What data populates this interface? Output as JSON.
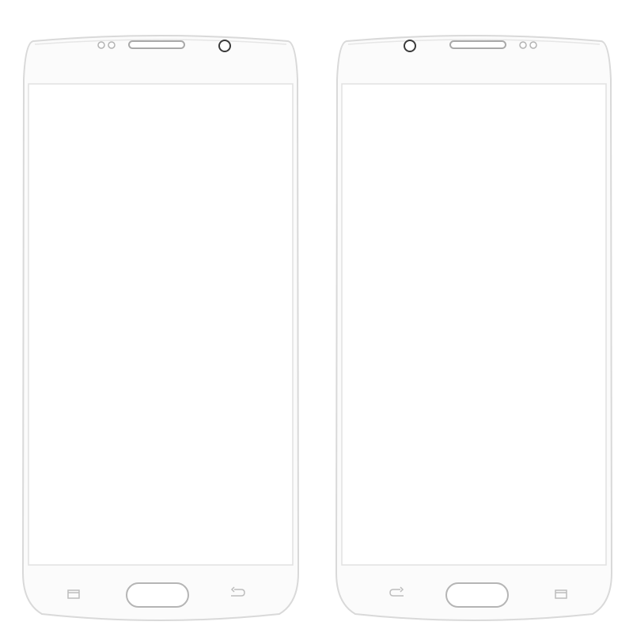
{
  "scene": {
    "background": "#ffffff",
    "glass_color": "#fbfbfb",
    "outline_color": "#d9d9d9",
    "detail_color": "#bdbdbd",
    "icon_color": "#b8b8b8"
  },
  "panels": [
    {
      "view": "front",
      "flipped": false,
      "icons": [
        "speaker-grille-icon",
        "sensor-dots-icon",
        "front-camera-icon",
        "home-button-icon",
        "recent-apps-icon",
        "back-arrow-icon"
      ]
    },
    {
      "view": "front-mirrored",
      "flipped": true,
      "icons": [
        "speaker-grille-icon",
        "sensor-dots-icon",
        "front-camera-icon",
        "home-button-icon",
        "recent-apps-icon",
        "back-arrow-icon"
      ]
    }
  ]
}
